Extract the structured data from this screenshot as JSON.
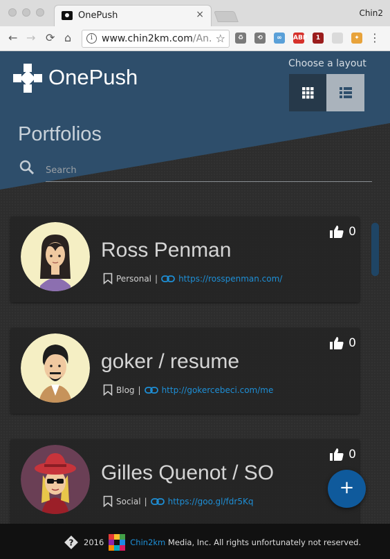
{
  "browser": {
    "tab_title": "OnePush",
    "tab_close": "×",
    "profile_name": "Chin2",
    "url_host": "www.chin2km.com",
    "url_rest": "/An...",
    "nav_back": "←",
    "nav_forward": "→",
    "nav_reload": "⟳",
    "nav_home": "⌂",
    "star": "☆",
    "menu": "⋮",
    "extensions": [
      {
        "name": "recycle-extension-icon",
        "color": "#7a7a7a",
        "glyph": "♻"
      },
      {
        "name": "clock-extension-icon",
        "color": "#7a7a7a",
        "glyph": "⟲"
      },
      {
        "name": "swirl-extension-icon",
        "color": "#5aa0d8",
        "glyph": "∞"
      },
      {
        "name": "adblock-plus-icon",
        "color": "#d6312b",
        "glyph": "ABP"
      },
      {
        "name": "ublock-icon",
        "color": "#9b1d1d",
        "glyph": "1"
      },
      {
        "name": "grid-extension-icon",
        "color": "#dadada",
        "glyph": ""
      },
      {
        "name": "pinwheel-extension-icon",
        "color": "#e8a33b",
        "glyph": "✦"
      }
    ]
  },
  "app": {
    "brand": "OnePush",
    "layout_label": "Choose a layout",
    "page_title": "Portfolios",
    "search_placeholder": "Search",
    "fab_label": "+",
    "colors": {
      "header": "#2e4e6b",
      "link": "#1e8fd6",
      "fab": "#0f5a9c"
    }
  },
  "portfolios": [
    {
      "name": "Ross Penman",
      "category": "Personal",
      "url": "https://rosspenman.com/",
      "likes": "0",
      "avatar": "woman-avatar-icon"
    },
    {
      "name": "goker / resume",
      "category": "Blog",
      "url": "http://gokercebeci.com/me",
      "likes": "0",
      "avatar": "bearded-man-avatar-icon"
    },
    {
      "name": "Gilles Quenot / SO",
      "category": "Social",
      "url": "https://goo.gl/fdr5Kq",
      "likes": "0",
      "avatar": "hat-sunglasses-avatar-icon"
    }
  ],
  "footer": {
    "year": "2016",
    "company": "Chin2km",
    "rest": "Media, Inc. All rights unfortunately not reserved."
  }
}
